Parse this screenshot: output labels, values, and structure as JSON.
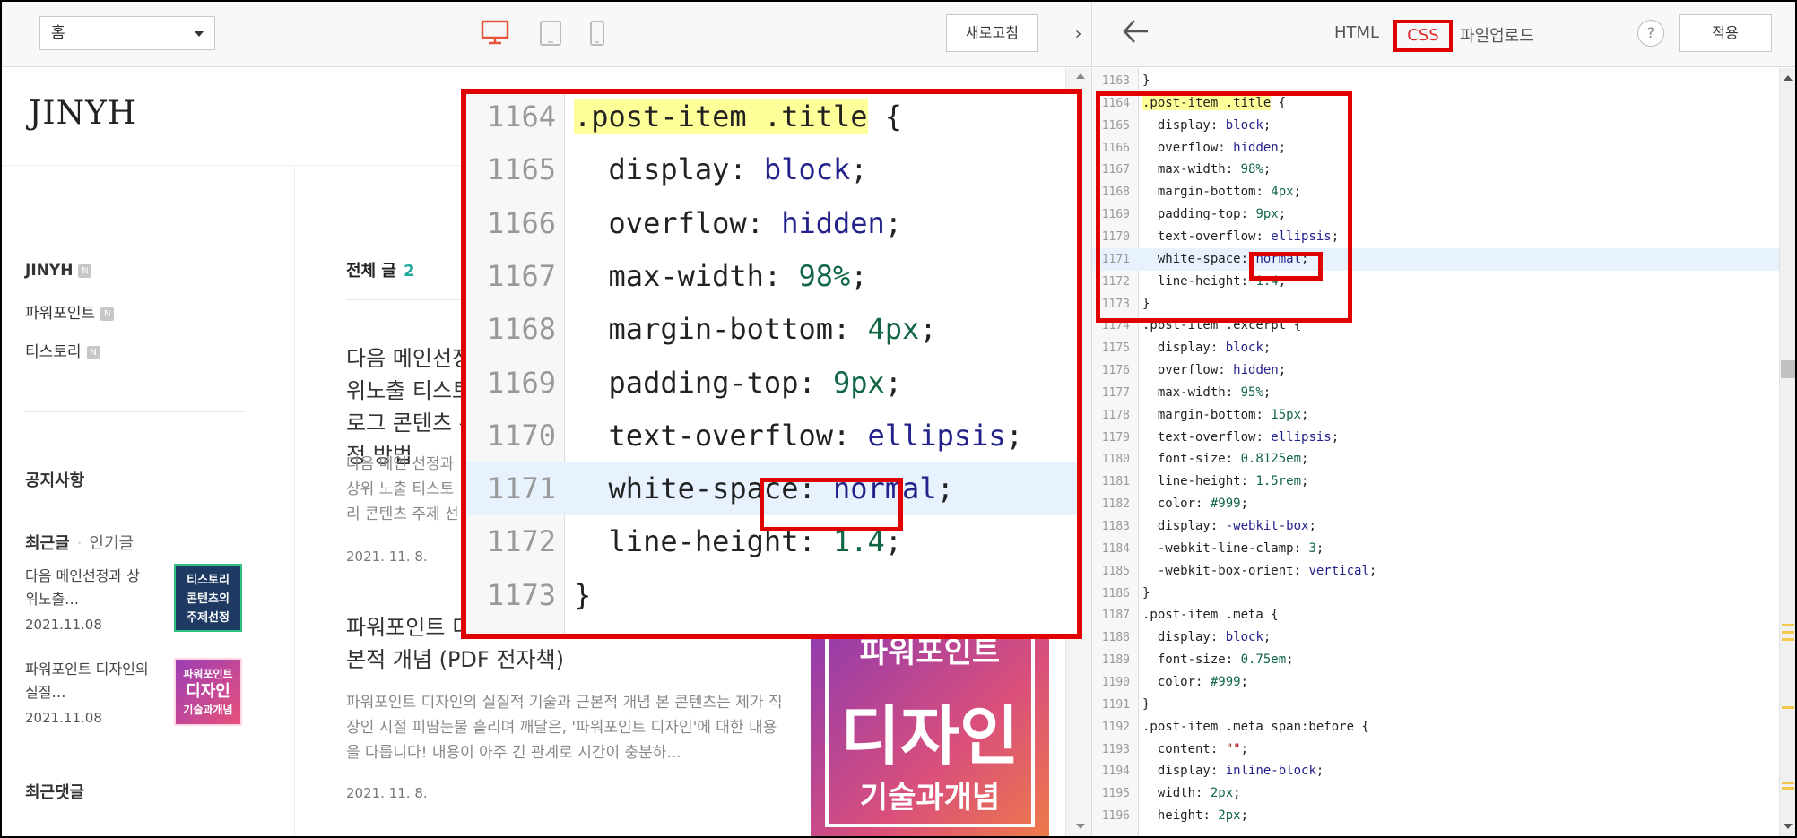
{
  "left_toolbar": {
    "page_select": "홈",
    "refresh_label": "새로고침",
    "collapse_glyph": "›"
  },
  "blog": {
    "logo": "JINYH",
    "sidebar": [
      {
        "label": "JINYH",
        "badge": "N"
      },
      {
        "label": "파워포인트",
        "badge": "N"
      },
      {
        "label": "티스토리",
        "badge": "N"
      }
    ],
    "notice_heading": "공지사항",
    "recent_tab_active": "최근글",
    "recent_tab_inactive": "인기글",
    "recent_posts": [
      {
        "title": "다음 메인선정과 상위노출…",
        "date": "2021.11.08",
        "thumb": [
          "티스토리",
          "콘텐츠의",
          "주제선정"
        ]
      },
      {
        "title": "파워포인트 디자인의 실질…",
        "date": "2021.11.08",
        "thumb": [
          "파워포인트",
          "디자인",
          "기술과개념"
        ]
      }
    ],
    "recent_comments_heading": "최근댓글",
    "all_posts_label": "전체 글",
    "all_posts_count": "2",
    "posts": [
      {
        "title": "다음 메인선정과 상위노출 티스토리 블로그 콘텐츠 주제 선정 방법",
        "excerpt": "다음 메인 선정과 상위 노출 티스토리 콘텐츠 주제 선정 방법에 대해 익명 티스토리 블로그에서 알아봅니다",
        "date": "2021. 11. 8."
      },
      {
        "title": "파워포인트 디자인의 실질적 기술과 근본적 개념 (PDF 전자책)",
        "excerpt": "파워포인트 디자인의 실질적 기술과 근본적 개념 본 콘텐츠는 제가 직장인 시절 피땀눈물 흘리며 깨달은, '파워포인트 디자인'에 대한 내용을 다룹니다! 내용이 아주 긴 관계로 시간이 충분하...",
        "date": "2021. 11. 8.",
        "thumb": [
          "파워포인트",
          "디자인",
          "기술과개념"
        ]
      }
    ]
  },
  "editor_toolbar": {
    "tab_html": "HTML",
    "tab_css": "CSS",
    "tab_upload": "파일업로드",
    "help": "?",
    "apply": "적용"
  },
  "code_lines": [
    {
      "n": "1163",
      "t": "}"
    },
    {
      "n": "1164",
      "t": ".post-item .title {"
    },
    {
      "n": "1165",
      "t": "  display: block;"
    },
    {
      "n": "1166",
      "t": "  overflow: hidden;"
    },
    {
      "n": "1167",
      "t": "  max-width: 98%;"
    },
    {
      "n": "1168",
      "t": "  margin-bottom: 4px;"
    },
    {
      "n": "1169",
      "t": "  padding-top: 9px;"
    },
    {
      "n": "1170",
      "t": "  text-overflow: ellipsis;"
    },
    {
      "n": "1171",
      "t": "  white-space: normal;"
    },
    {
      "n": "1172",
      "t": "  line-height: 1.4;"
    },
    {
      "n": "1173",
      "t": "}"
    },
    {
      "n": "1174",
      "t": ".post-item .excerpt {"
    },
    {
      "n": "1175",
      "t": "  display: block;"
    },
    {
      "n": "1176",
      "t": "  overflow: hidden;"
    },
    {
      "n": "1177",
      "t": "  max-width: 95%;"
    },
    {
      "n": "1178",
      "t": "  margin-bottom: 15px;"
    },
    {
      "n": "1179",
      "t": "  text-overflow: ellipsis;"
    },
    {
      "n": "1180",
      "t": "  font-size: 0.8125em;"
    },
    {
      "n": "1181",
      "t": "  line-height: 1.5rem;"
    },
    {
      "n": "1182",
      "t": "  color: #999;"
    },
    {
      "n": "1183",
      "t": "  display: -webkit-box;"
    },
    {
      "n": "1184",
      "t": "  -webkit-line-clamp: 3;"
    },
    {
      "n": "1185",
      "t": "  -webkit-box-orient: vertical;"
    },
    {
      "n": "1186",
      "t": "}"
    },
    {
      "n": "1187",
      "t": ".post-item .meta {"
    },
    {
      "n": "1188",
      "t": "  display: block;"
    },
    {
      "n": "1189",
      "t": "  font-size: 0.75em;"
    },
    {
      "n": "1190",
      "t": "  color: #999;"
    },
    {
      "n": "1191",
      "t": "}"
    },
    {
      "n": "1192",
      "t": ".post-item .meta span:before {"
    },
    {
      "n": "1193",
      "t": "  content: \"\";"
    },
    {
      "n": "1194",
      "t": "  display: inline-block;"
    },
    {
      "n": "1195",
      "t": "  width: 2px;"
    },
    {
      "n": "1196",
      "t": "  height: 2px;"
    }
  ],
  "zoom": {
    "lines": [
      {
        "n": "1164",
        "t": ".post-item .title {"
      },
      {
        "n": "1165",
        "t": "  display: block;"
      },
      {
        "n": "1166",
        "t": "  overflow: hidden;"
      },
      {
        "n": "1167",
        "t": "  max-width: 98%;"
      },
      {
        "n": "1168",
        "t": "  margin-bottom: 4px;"
      },
      {
        "n": "1169",
        "t": "  padding-top: 9px;"
      },
      {
        "n": "1170",
        "t": "  text-overflow: ellipsis;"
      },
      {
        "n": "1171",
        "t": "  white-space: normal;"
      },
      {
        "n": "1172",
        "t": "  line-height: 1.4;"
      },
      {
        "n": "1173",
        "t": "}"
      }
    ]
  },
  "colors": {
    "annotation_red": "#e00000",
    "accent_teal": "#1ea79c",
    "device_active": "#e8553a",
    "line_highlight": "#e8f2ff",
    "selector_highlight": "#ffff99"
  }
}
